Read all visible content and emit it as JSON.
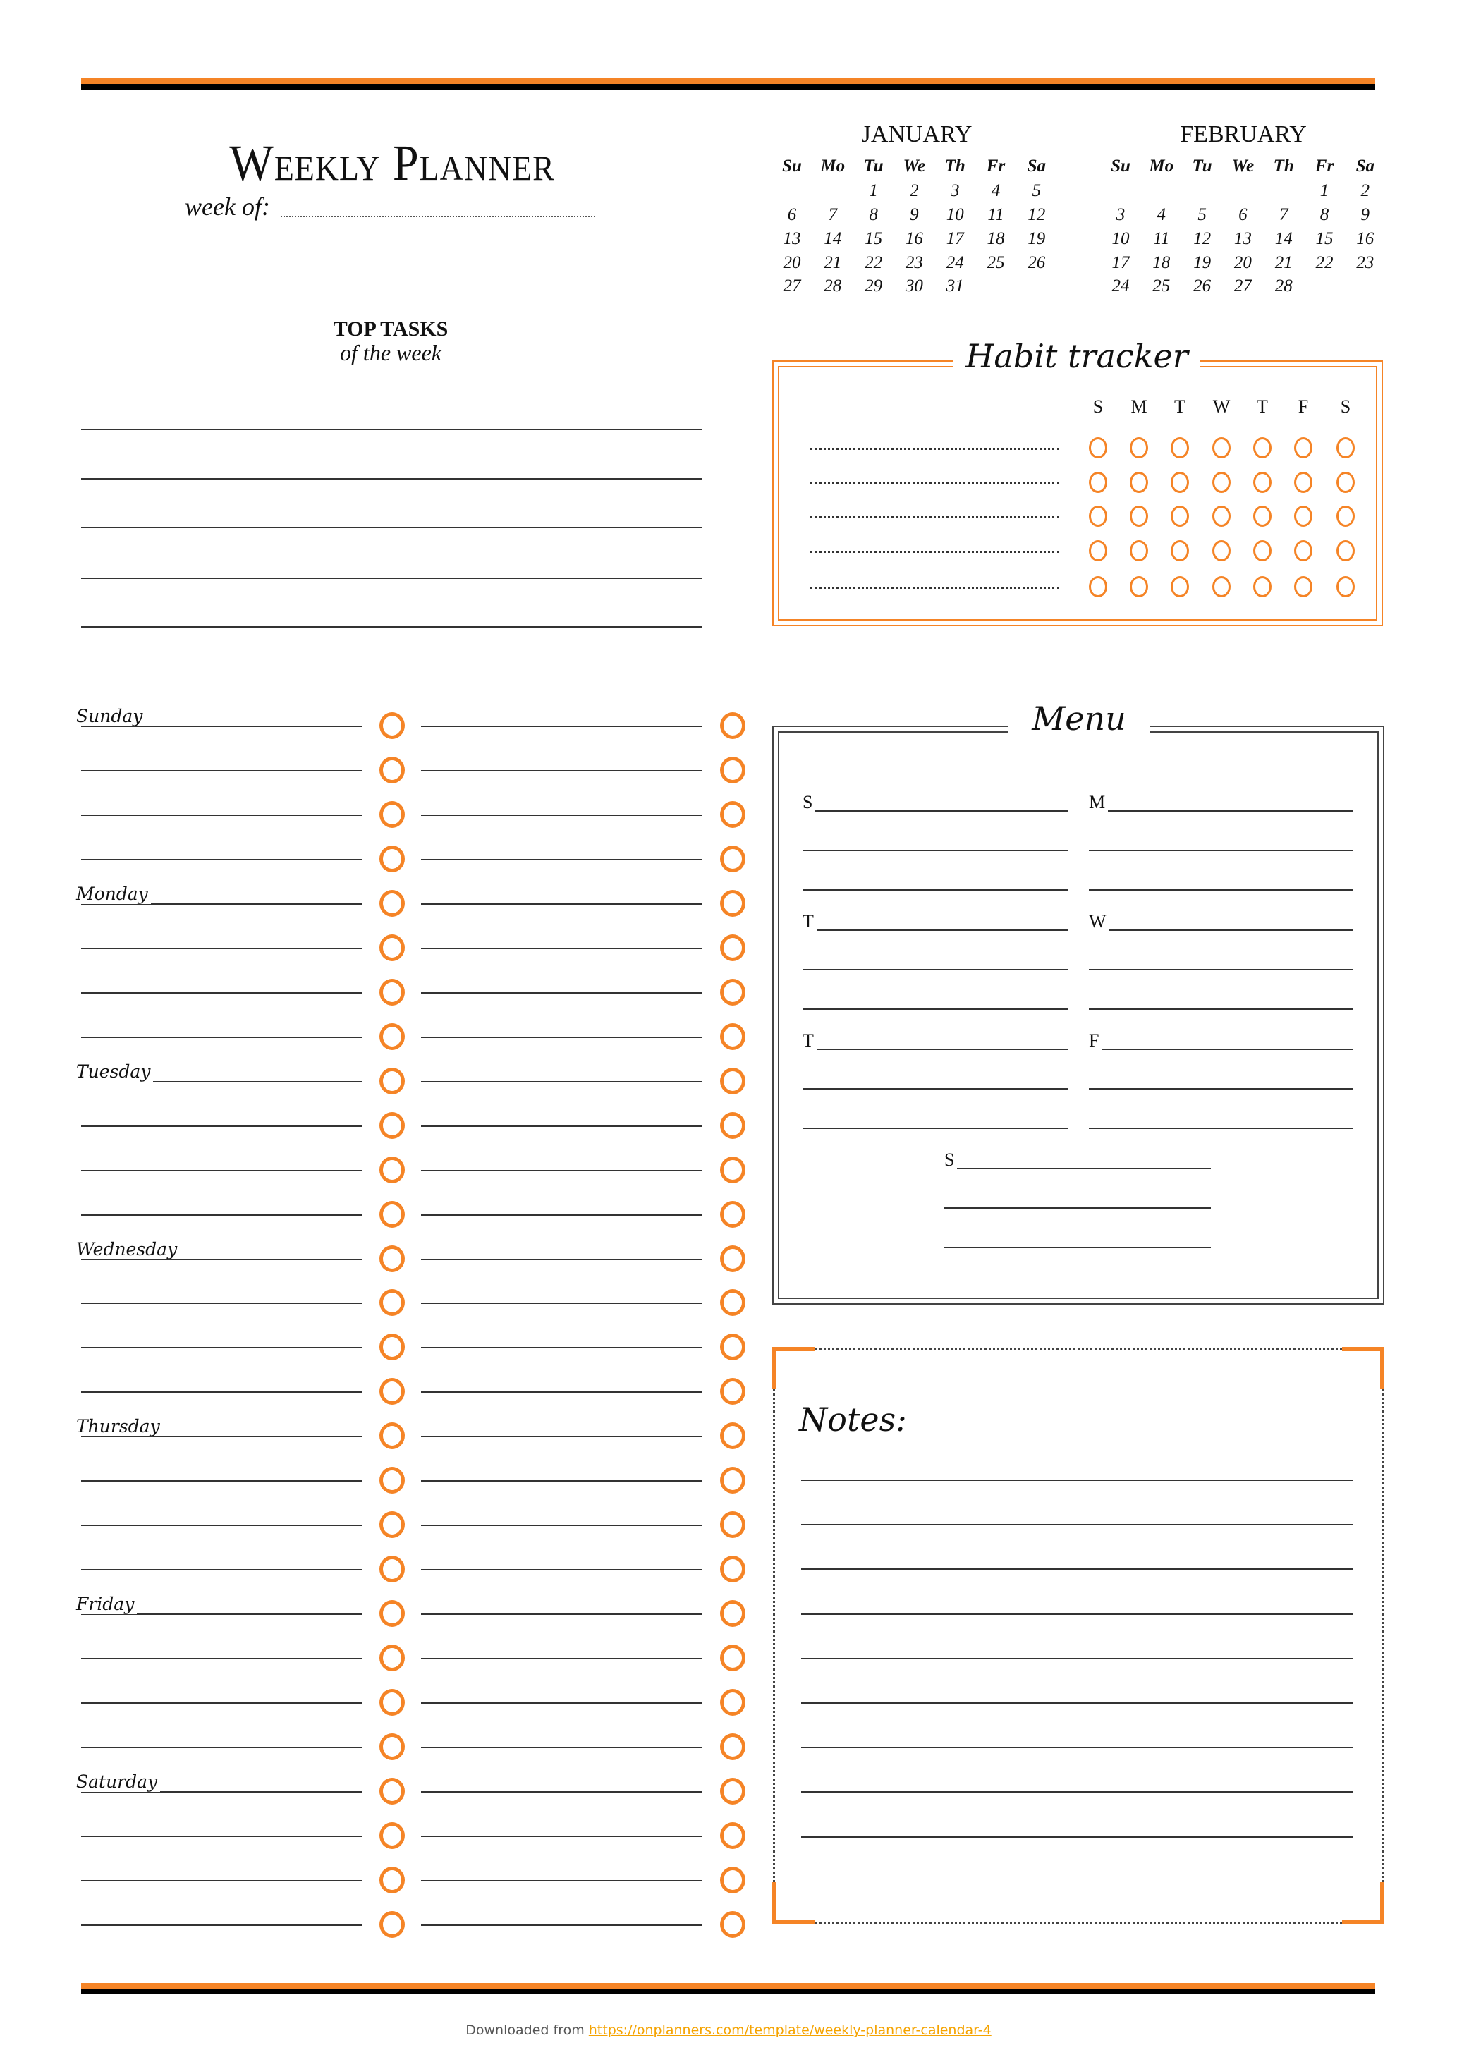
{
  "header": {
    "title": "Weekly Planner",
    "week_of_label": "week of:"
  },
  "calendars": [
    {
      "month": "JANUARY",
      "weekdays": [
        "Su",
        "Mo",
        "Tu",
        "We",
        "Th",
        "Fr",
        "Sa"
      ],
      "weeks": [
        [
          "",
          "",
          "1",
          "2",
          "3",
          "4",
          "5"
        ],
        [
          "6",
          "7",
          "8",
          "9",
          "10",
          "11",
          "12"
        ],
        [
          "13",
          "14",
          "15",
          "16",
          "17",
          "18",
          "19"
        ],
        [
          "20",
          "21",
          "22",
          "23",
          "24",
          "25",
          "26"
        ],
        [
          "27",
          "28",
          "29",
          "30",
          "31",
          "",
          ""
        ]
      ]
    },
    {
      "month": "FEBRUARY",
      "weekdays": [
        "Su",
        "Mo",
        "Tu",
        "We",
        "Th",
        "Fr",
        "Sa"
      ],
      "weeks": [
        [
          "",
          "",
          "",
          "",
          "",
          "1",
          "2"
        ],
        [
          "3",
          "4",
          "5",
          "6",
          "7",
          "8",
          "9"
        ],
        [
          "10",
          "11",
          "12",
          "13",
          "14",
          "15",
          "16"
        ],
        [
          "17",
          "18",
          "19",
          "20",
          "21",
          "22",
          "23"
        ],
        [
          "24",
          "25",
          "26",
          "27",
          "28",
          "",
          ""
        ]
      ]
    }
  ],
  "top_tasks": {
    "title": "TOP TASKS",
    "subtitle": "of the week",
    "line_count": 5
  },
  "habit_tracker": {
    "title": "Habit tracker",
    "days": [
      "S",
      "M",
      "T",
      "W",
      "T",
      "F",
      "S"
    ],
    "habit_count": 5
  },
  "daily_tasks": {
    "days": [
      "Sunday",
      "Monday",
      "Tuesday",
      "Wednesday",
      "Thursday",
      "Friday",
      "Saturday"
    ],
    "rows_per_day": 4
  },
  "menu": {
    "title": "Menu",
    "days": [
      "S",
      "M",
      "T",
      "W",
      "T",
      "F",
      "S"
    ]
  },
  "notes": {
    "title": "Notes:",
    "line_count": 9
  },
  "footer": {
    "prefix": "Downloaded from",
    "link": "https://onplanners.com/template/weekly-planner-calendar-4"
  },
  "colors": {
    "accent": "#F58426",
    "ink": "#111111"
  }
}
